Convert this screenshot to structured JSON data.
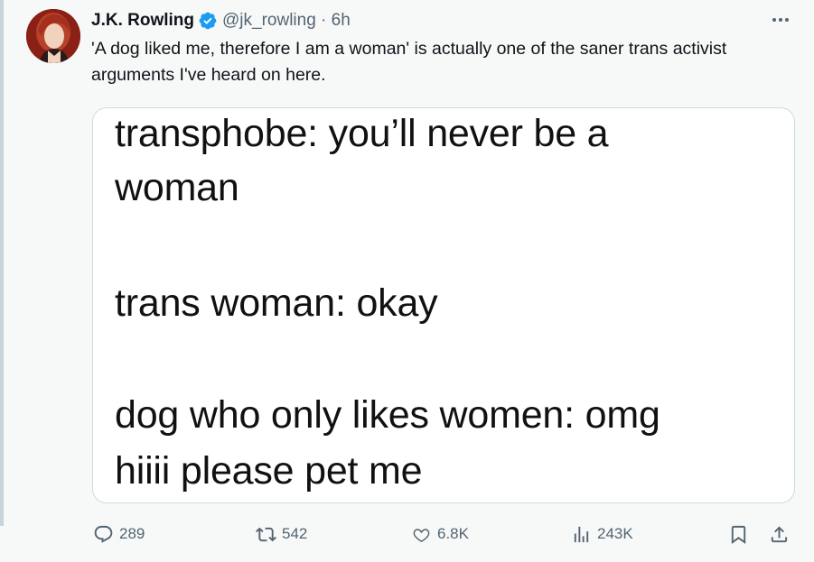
{
  "tweet": {
    "author_name": "J.K. Rowling",
    "handle_and_time": "@jk_rowling · 6h",
    "text": "'A dog liked me, therefore I am a woman' is actually one of the saner trans activist arguments I've heard on here.",
    "verified_badge_color": "#1d9bf0",
    "media_lines": [
      "transphobe: you’ll never be a",
      "woman",
      "trans woman: okay",
      "dog who only likes women: omg",
      "hiiii please pet me"
    ]
  },
  "actions": {
    "replies": "289",
    "reposts": "542",
    "likes": "6.8K",
    "views": "243K"
  },
  "icons": {
    "reply": "reply-icon",
    "repost": "repost-icon",
    "like": "heart-icon",
    "views": "views-icon",
    "bookmark": "bookmark-icon",
    "share": "share-icon",
    "more": "more-icon",
    "verified": "verified-badge-icon"
  }
}
